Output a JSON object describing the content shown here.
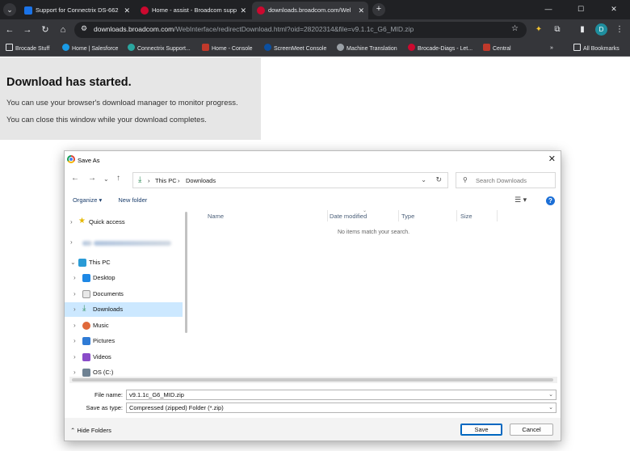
{
  "browser": {
    "tabs": [
      {
        "title": "Support for Connectrix DS-662",
        "active": false
      },
      {
        "title": "Home - assist - Broadcom supp",
        "active": false
      },
      {
        "title": "downloads.broadcom.com/Wel",
        "active": true
      }
    ],
    "url_host": "downloads.broadcom.com",
    "url_path": "/WebInterface/redirectDownload.html?oid=28202314&file=v9.1.1c_G6_MID.zip",
    "profile_initial": "D",
    "bookmarks": [
      {
        "label": "Brocade Stuff",
        "icon": "folder"
      },
      {
        "label": "Home | Salesforce",
        "icon": "salesforce"
      },
      {
        "label": "Connectrix Support...",
        "icon": "connectrix"
      },
      {
        "label": "Home - Console",
        "icon": "pr"
      },
      {
        "label": "ScreenMeet Console",
        "icon": "screenmeet"
      },
      {
        "label": "Machine Translation",
        "icon": "translate"
      },
      {
        "label": "Brocade-Diags - Let...",
        "icon": "broadcom"
      },
      {
        "label": "Central",
        "icon": "pr"
      }
    ],
    "all_bookmarks": "All Bookmarks"
  },
  "page": {
    "title": "Download has started.",
    "line1": "You can use your browser's download manager to monitor progress.",
    "line2": "You can close this window while your download completes."
  },
  "dialog": {
    "title": "Save As",
    "breadcrumb": [
      "This PC",
      "Downloads"
    ],
    "search_placeholder": "Search Downloads",
    "organize": "Organize",
    "new_folder": "New folder",
    "tree": [
      {
        "label": "Quick access",
        "icon": "star-icon"
      },
      {
        "label": "",
        "icon": "cloud-icon",
        "blurred": true
      },
      {
        "label": "This PC",
        "icon": "computer-icon"
      },
      {
        "label": "Desktop",
        "icon": "desktop-icon"
      },
      {
        "label": "Documents",
        "icon": "documents-icon"
      },
      {
        "label": "Downloads",
        "icon": "download-icon",
        "selected": true
      },
      {
        "label": "Music",
        "icon": "music-icon"
      },
      {
        "label": "Pictures",
        "icon": "pictures-icon"
      },
      {
        "label": "Videos",
        "icon": "videos-icon"
      },
      {
        "label": "OS (C:)",
        "icon": "drive-icon"
      }
    ],
    "columns": [
      "Name",
      "Date modified",
      "Type",
      "Size"
    ],
    "empty_message": "No items match your search.",
    "file_name_label": "File name:",
    "file_name": "v9.1.1c_G6_MID.zip",
    "save_type_label": "Save as type:",
    "save_type": "Compressed (zipped) Folder (*.zip)",
    "hide_folders": "Hide Folders",
    "save": "Save",
    "cancel": "Cancel"
  }
}
